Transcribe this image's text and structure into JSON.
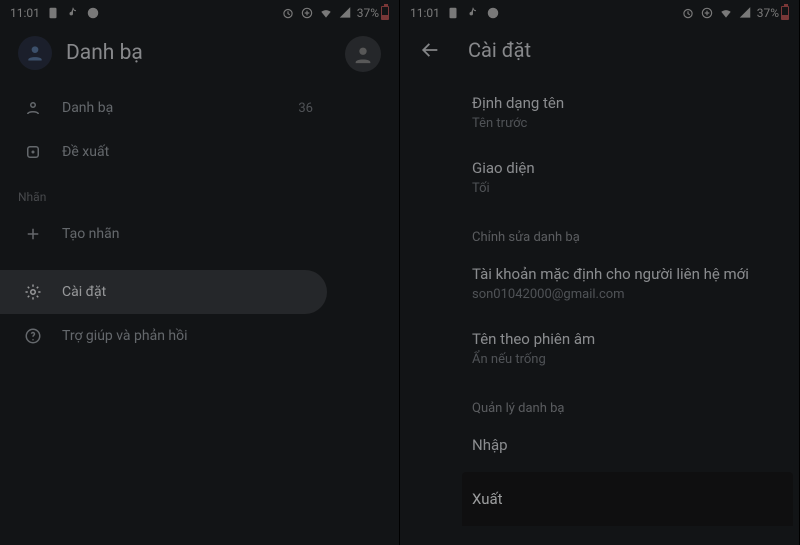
{
  "status": {
    "time": "11:01",
    "battery": "37%"
  },
  "left": {
    "appTitle": "Danh bạ",
    "items": {
      "contacts": {
        "label": "Danh bạ",
        "count": "36"
      },
      "suggest": {
        "label": "Đề xuất"
      }
    },
    "labelSection": "Nhãn",
    "createLabel": "Tạo nhãn",
    "settings": "Cài đặt",
    "help": "Trợ giúp và phản hồi"
  },
  "right": {
    "title": "Cài đặt",
    "nameFormat": {
      "title": "Định dạng tên",
      "sub": "Tên trước"
    },
    "theme": {
      "title": "Giao diện",
      "sub": "Tối"
    },
    "editSection": "Chỉnh sửa danh bạ",
    "defaultAccount": {
      "title": "Tài khoản mặc định cho người liên hệ mới",
      "sub": "son01042000@gmail.com"
    },
    "phonetic": {
      "title": "Tên theo phiên âm",
      "sub": "Ẩn nếu trống"
    },
    "manageSection": "Quản lý danh bạ",
    "import": "Nhập",
    "export": "Xuất"
  }
}
